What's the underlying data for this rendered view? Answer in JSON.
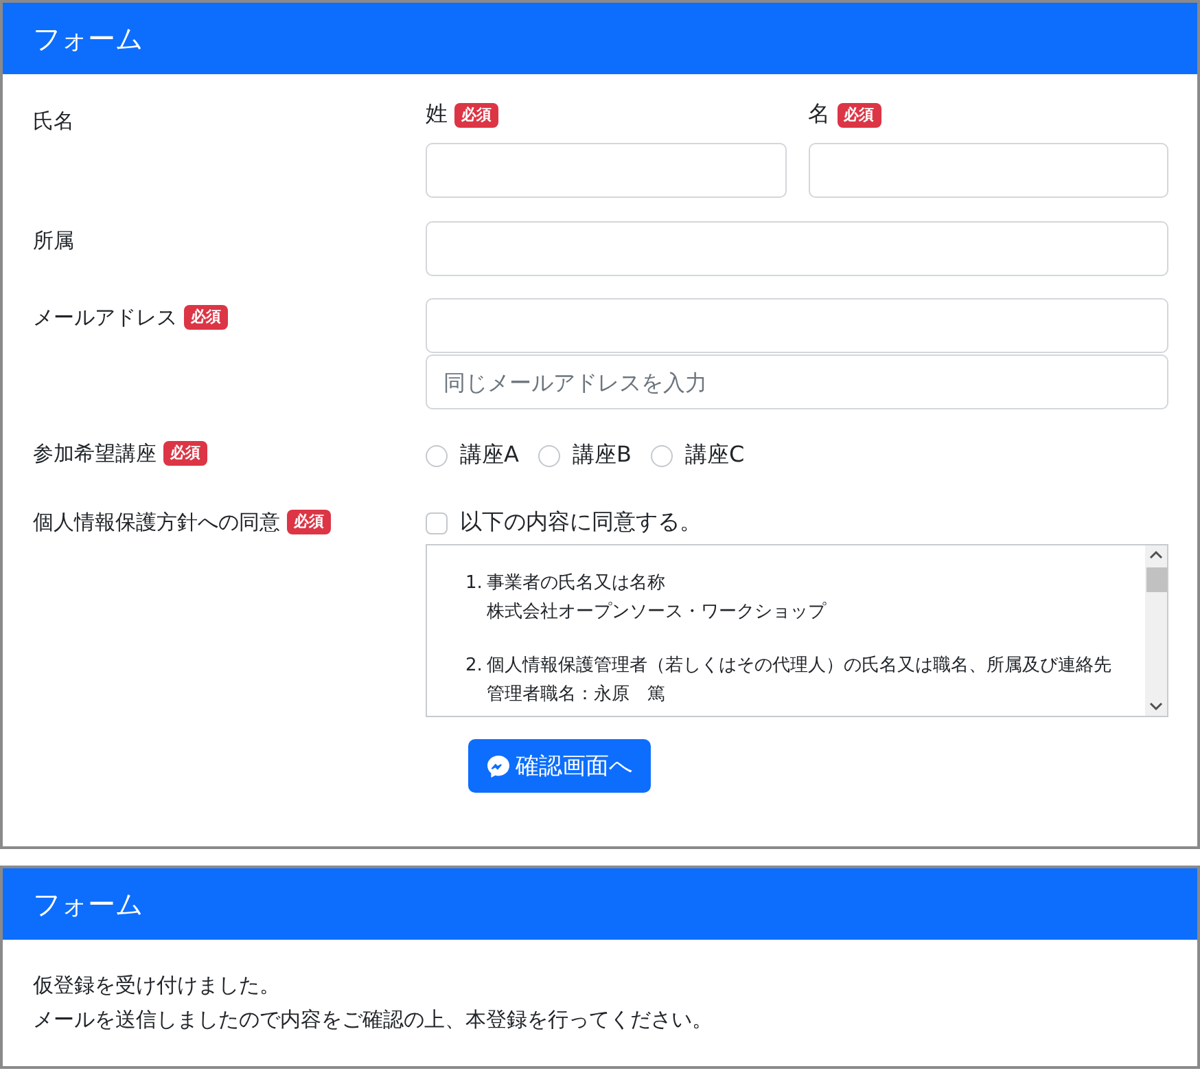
{
  "entry_form": {
    "title": "フォーム",
    "rows": [
      {
        "kind": "name",
        "label": "氏名",
        "fields": [
          {
            "label": "姓",
            "badge": "必須"
          },
          {
            "label": "名",
            "badge": "必須"
          }
        ]
      },
      {
        "kind": "text",
        "label": "所属"
      },
      {
        "kind": "email",
        "label": "メールアドレス",
        "badge": "必須",
        "confirm_placeholder": "同じメールアドレスを入力"
      },
      {
        "kind": "radio",
        "label": "参加希望講座",
        "badge": "必須",
        "options": [
          {
            "label": "講座A",
            "selected": false
          },
          {
            "label": "講座B",
            "selected": false
          },
          {
            "label": "講座C",
            "selected": false
          }
        ]
      },
      {
        "kind": "consent",
        "label": "個人情報保護方針への同意",
        "badge": "必須",
        "checkbox": {
          "label": "以下の内容に同意する。",
          "checked": false
        },
        "policy": [
          {
            "number": "1.",
            "title": "事業者の氏名又は名称",
            "detail": "株式会社オープンソース・ワークショップ"
          },
          {
            "number": "2.",
            "title": "個人情報保護管理者（若しくはその代理人）の氏名又は職名、所属及び連絡先",
            "detail": "管理者職名：永原　篤"
          }
        ]
      }
    ],
    "submit": "確認画面へ"
  },
  "result_card": {
    "title": "フォーム",
    "lines": [
      "仮登録を受け付けました。",
      "メールを送信しましたので内容をご確認の上、本登録を行ってください。"
    ]
  }
}
